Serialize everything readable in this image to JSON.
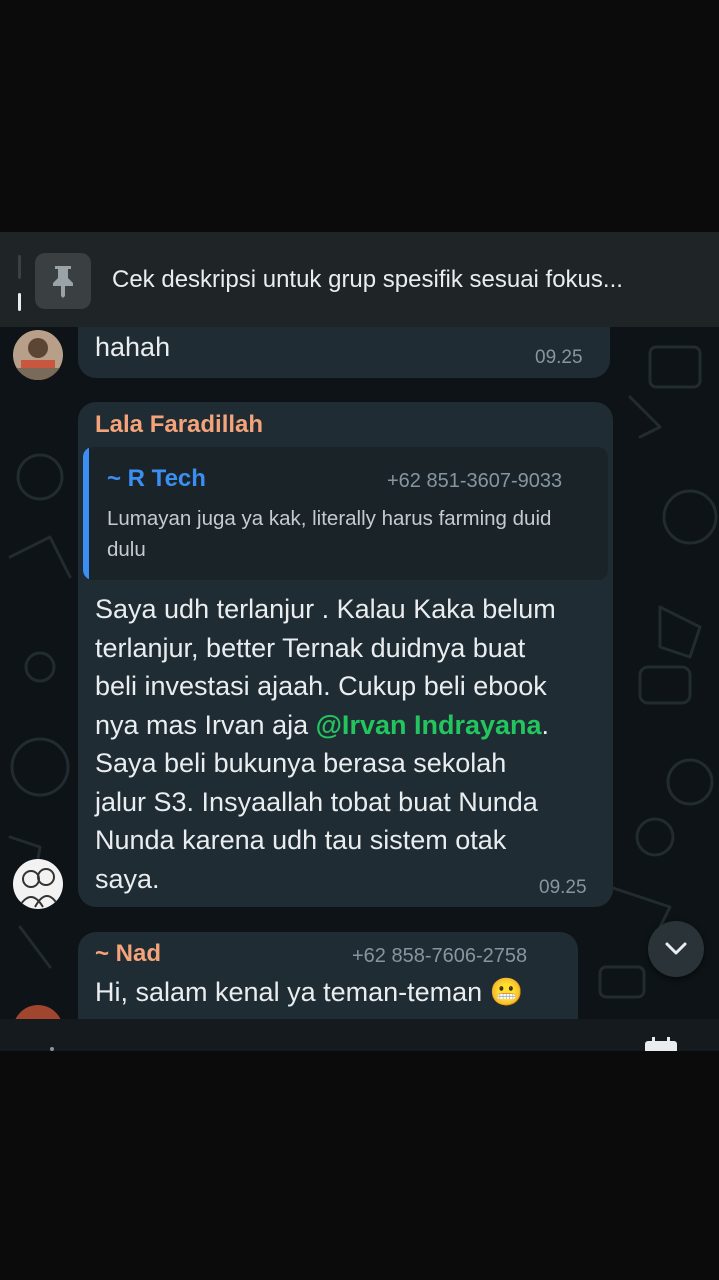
{
  "pinned": {
    "text": "Cek deskripsi untuk grup spesifik sesuai fokus..."
  },
  "messages": [
    {
      "text": "hahah",
      "time": "09.25"
    },
    {
      "sender": "Lala Faradillah",
      "quote": {
        "sender": "~ R Tech",
        "phone": "+62 851-3607-9033",
        "text": "Lumayan juga ya kak, literally harus farming duid dulu"
      },
      "text_lines": [
        "Saya udh terlanjur . Kalau Kaka belum",
        "terlanjur, better Ternak duidnya buat",
        "beli investasi ajaah. Cukup beli ebook",
        "nya mas Irvan aja ",
        "Saya beli bukunya berasa sekolah",
        "jalur S3. Insyaallah tobat buat Nunda",
        "Nunda karena udh tau sistem otak",
        "saya."
      ],
      "mention": "@Irvan Indrayana",
      "mention_suffix": ".",
      "time": "09.25"
    },
    {
      "sender": "~ Nad",
      "phone": "+62 858-7606-2758",
      "text": "Hi, salam kenal ya teman-teman",
      "emoji": "😬"
    }
  ],
  "colors": {
    "bubble": "#202c33",
    "sender_orange": "#f4a37a",
    "quote_blue": "#3b8ff3",
    "mention_green": "#22c55e",
    "time_gray": "#8696a0"
  },
  "icons": {
    "pin": "pin-icon",
    "scroll_down": "chevron-down-icon",
    "calendar": "calendar-icon"
  }
}
